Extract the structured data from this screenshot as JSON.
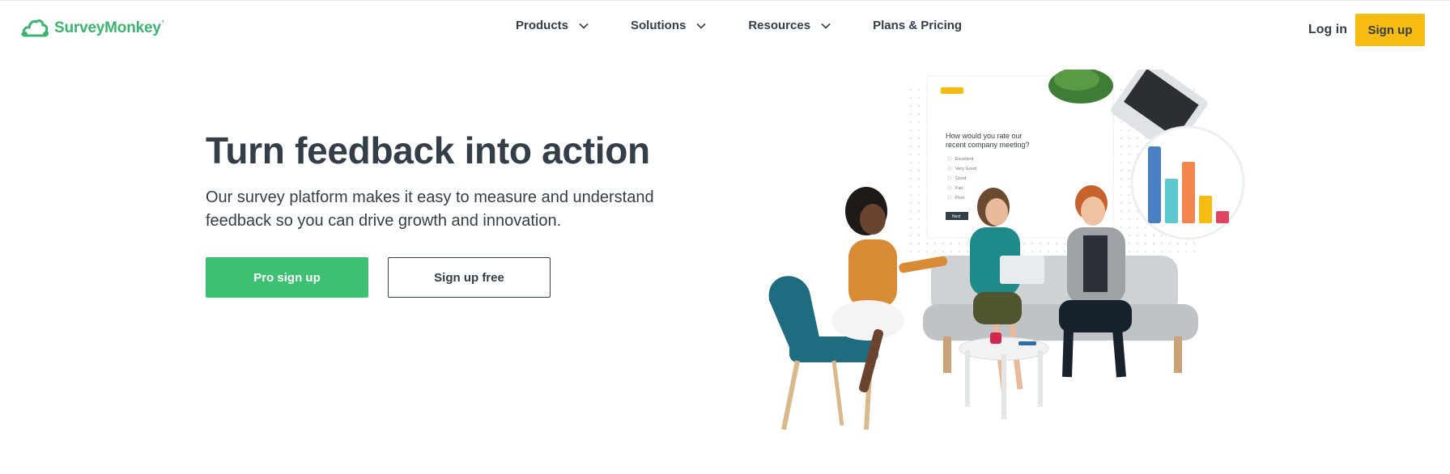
{
  "brand": {
    "name": "SurveyMonkey",
    "trademark": "’",
    "color": "#3cb371"
  },
  "nav": {
    "products": "Products",
    "solutions": "Solutions",
    "resources": "Resources",
    "pricing": "Plans & Pricing"
  },
  "header": {
    "login": "Log in",
    "signup": "Sign up",
    "signup_color": "#f7bc11"
  },
  "hero": {
    "title": "Turn feedback into action",
    "subtitle": "Our survey platform makes it easy to measure and understand feedback so you can drive growth and innovation.",
    "pro_button": "Pro sign up",
    "pro_button_color": "#3cc172",
    "free_button": "Sign up free"
  },
  "illustration": {
    "survey_question": [
      "How would you rate our",
      "recent company meeting?"
    ],
    "options": [
      "Excellent",
      "Very Good",
      "Good",
      "Fair",
      "Poor"
    ],
    "next_button": "Next",
    "chart_bar_colors": [
      "#4a7fc1",
      "#5bc8d0",
      "#f2854b",
      "#f7bc11",
      "#e0455f"
    ]
  }
}
